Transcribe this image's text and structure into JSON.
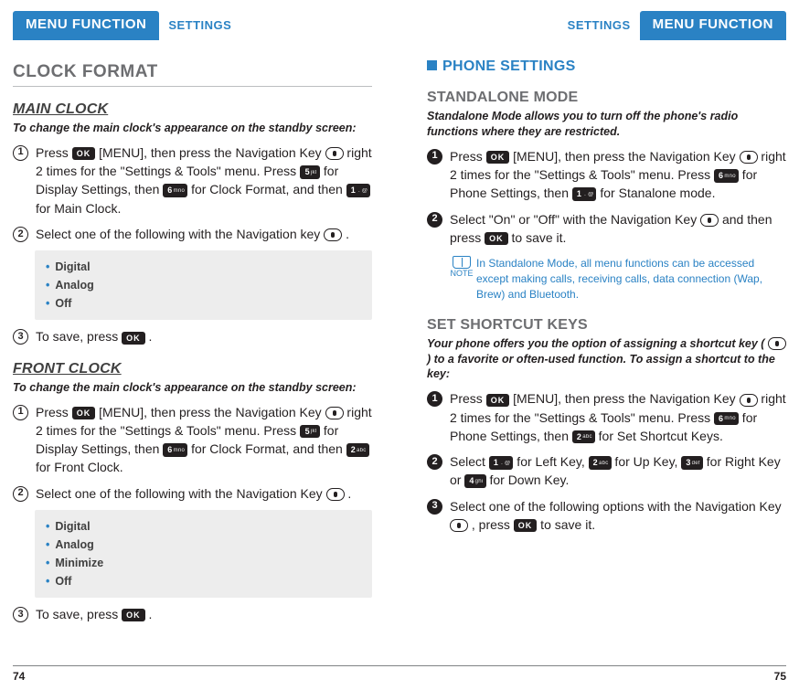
{
  "tab_active": "MENU FUNCTION",
  "tab_inactive": "SETTINGS",
  "keys": {
    "ok": "OK",
    "nav": "nav",
    "1": {
      "n": "1",
      "s": " . @"
    },
    "2": {
      "n": "2",
      "s": "abc"
    },
    "3": {
      "n": "3",
      "s": "def"
    },
    "4": {
      "n": "4",
      "s": "ghi"
    },
    "5": {
      "n": "5",
      "s": "jkl"
    },
    "6": {
      "n": "6",
      "s": "mno"
    }
  },
  "left": {
    "section": "CLOCK FORMAT",
    "main_clock": {
      "heading": "MAIN CLOCK",
      "intro": "To change the main clock's appearance on the standby screen:",
      "steps": [
        {
          "parts": [
            {
              "t": "Press "
            },
            {
              "key": "ok"
            },
            {
              "t": " [MENU], then press the Navigation Key "
            },
            {
              "key": "nav"
            },
            {
              "t": " right 2 times for the \"Settings & Tools\" menu. Press "
            },
            {
              "key": "5"
            },
            {
              "t": " for Display Settings, then "
            },
            {
              "key": "6"
            },
            {
              "t": " for Clock Format, and then "
            },
            {
              "key": "1"
            },
            {
              "t": " for Main Clock."
            }
          ]
        },
        {
          "parts": [
            {
              "t": "Select one of the following with the Navigation key "
            },
            {
              "key": "nav"
            },
            {
              "t": " ."
            }
          ],
          "options": [
            "Digital",
            "Analog",
            "Off"
          ]
        },
        {
          "parts": [
            {
              "t": "To save, press "
            },
            {
              "key": "ok"
            },
            {
              "t": " ."
            }
          ]
        }
      ]
    },
    "front_clock": {
      "heading": "FRONT CLOCK",
      "intro": "To change the main clock's appearance on the standby screen:",
      "steps": [
        {
          "parts": [
            {
              "t": "Press "
            },
            {
              "key": "ok"
            },
            {
              "t": " [MENU], then press the Navigation Key "
            },
            {
              "key": "nav"
            },
            {
              "t": " right 2 times for the \"Settings & Tools\" menu. Press "
            },
            {
              "key": "5"
            },
            {
              "t": " for Display Settings, then "
            },
            {
              "key": "6"
            },
            {
              "t": " for Clock Format, and then "
            },
            {
              "key": "2"
            },
            {
              "t": " for Front Clock."
            }
          ]
        },
        {
          "parts": [
            {
              "t": "Select one of the following with the Navigation Key "
            },
            {
              "key": "nav"
            },
            {
              "t": " ."
            }
          ],
          "options": [
            "Digital",
            "Analog",
            "Minimize",
            "Off"
          ]
        },
        {
          "parts": [
            {
              "t": "To save, press "
            },
            {
              "key": "ok"
            },
            {
              "t": " ."
            }
          ]
        }
      ]
    },
    "pagenum": "74"
  },
  "right": {
    "section": "PHONE SETTINGS",
    "standalone": {
      "heading": "STANDALONE MODE",
      "intro": "Standalone Mode allows you to turn off the phone's radio functions where they are restricted.",
      "steps": [
        {
          "parts": [
            {
              "t": "Press "
            },
            {
              "key": "ok"
            },
            {
              "t": " [MENU], then press the Navigation Key "
            },
            {
              "key": "nav"
            },
            {
              "t": " right 2 times for the \"Settings & Tools\" menu. Press "
            },
            {
              "key": "6"
            },
            {
              "t": " for Phone Settings, then "
            },
            {
              "key": "1"
            },
            {
              "t": " for Stanalone mode."
            }
          ]
        },
        {
          "parts": [
            {
              "t": "Select \"On\" or \"Off\" with the Navigation Key "
            },
            {
              "key": "nav"
            },
            {
              "t": " and then press "
            },
            {
              "key": "ok"
            },
            {
              "t": " to save it."
            }
          ]
        }
      ],
      "note_label": "NOTE",
      "note": "In Standalone Mode, all menu functions can be accessed except making calls, receiving calls, data connection (Wap, Brew) and Bluetooth."
    },
    "shortcut": {
      "heading": "SET SHORTCUT KEYS",
      "intro_parts": [
        {
          "t": "Your phone offers you the option of assigning a shortcut key ( "
        },
        {
          "key": "nav"
        },
        {
          "t": " ) to a favorite or often-used function. To assign a shortcut to the key:"
        }
      ],
      "steps": [
        {
          "parts": [
            {
              "t": "Press "
            },
            {
              "key": "ok"
            },
            {
              "t": " [MENU], then press the Navigation Key "
            },
            {
              "key": "nav"
            },
            {
              "t": " right 2 times for the \"Settings & Tools\" menu. Press "
            },
            {
              "key": "6"
            },
            {
              "t": " for Phone Settings, then "
            },
            {
              "key": "2"
            },
            {
              "t": " for Set Shortcut Keys."
            }
          ]
        },
        {
          "parts": [
            {
              "t": "Select "
            },
            {
              "key": "1"
            },
            {
              "t": " for Left Key, "
            },
            {
              "key": "2"
            },
            {
              "t": " for Up Key, "
            },
            {
              "key": "3"
            },
            {
              "t": " for Right Key or "
            },
            {
              "key": "4"
            },
            {
              "t": " for Down Key."
            }
          ]
        },
        {
          "parts": [
            {
              "t": "Select one of the following options with the Navigation Key "
            },
            {
              "key": "nav"
            },
            {
              "t": " , press "
            },
            {
              "key": "ok"
            },
            {
              "t": " to save it."
            }
          ]
        }
      ]
    },
    "pagenum": "75"
  }
}
